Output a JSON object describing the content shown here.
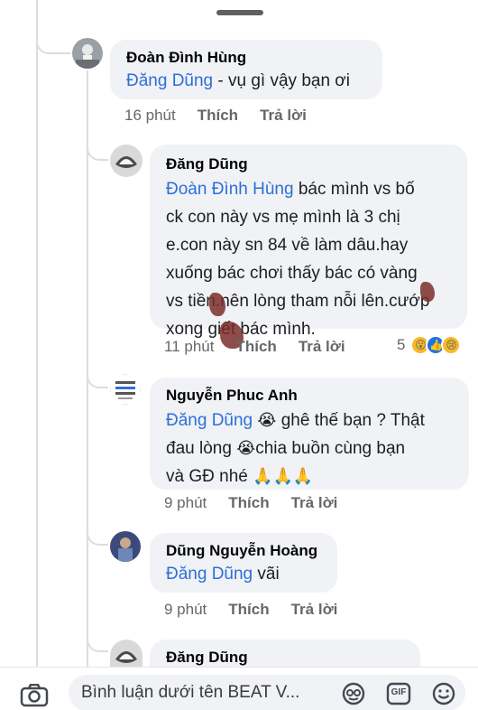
{
  "comments": [
    {
      "author": "Đoàn Đình Hùng",
      "mention": "Đăng Dũng",
      "text": " - vụ gì vậy bạn ơi",
      "time": "16 phút",
      "like_label": "Thích",
      "reply_label": "Trả lời"
    },
    {
      "author": "Đăng Dũng",
      "mention": "Đoàn Đình Hùng",
      "lines": [
        " bác mình vs bố",
        "ck con này vs mẹ mình là 3 chị",
        "e.con này sn 84 về làm dâu.hay",
        "xuống bác chơi thấy bác có vàng",
        "vs tiền.nên lòng tham nỗi lên.cướp",
        "xong giết bác mình."
      ],
      "time": "11 phút",
      "like_label": "Thích",
      "reply_label": "Trả lời",
      "reaction_count": "5"
    },
    {
      "author": "Nguyễn Phuc Anh",
      "mention": "Đăng Dũng",
      "line1_emoji": "😭",
      "line1_text": " ghê thế bạn ? Thật",
      "line2_text": "đau lòng ",
      "line2_emoji": "😭",
      "line2_text_b": "chia buồn cùng bạn",
      "line3_text": "và GĐ nhé ",
      "line3_emoji": "🙏🙏🙏",
      "time": "9 phút",
      "like_label": "Thích",
      "reply_label": "Trả lời"
    },
    {
      "author": "Dũng Nguyễn Hoàng",
      "mention": "Đăng Dũng",
      "text": " vãi",
      "time": "9 phút",
      "like_label": "Thích",
      "reply_label": "Trả lời"
    },
    {
      "author": "Đăng Dũng"
    }
  ],
  "composer": {
    "placeholder": "Bình luận dưới tên BEAT V...",
    "gif_label": "GIF"
  },
  "colors": {
    "link": "#2d6fd6",
    "bubble": "#f0f2f5",
    "meta": "#65676b"
  }
}
